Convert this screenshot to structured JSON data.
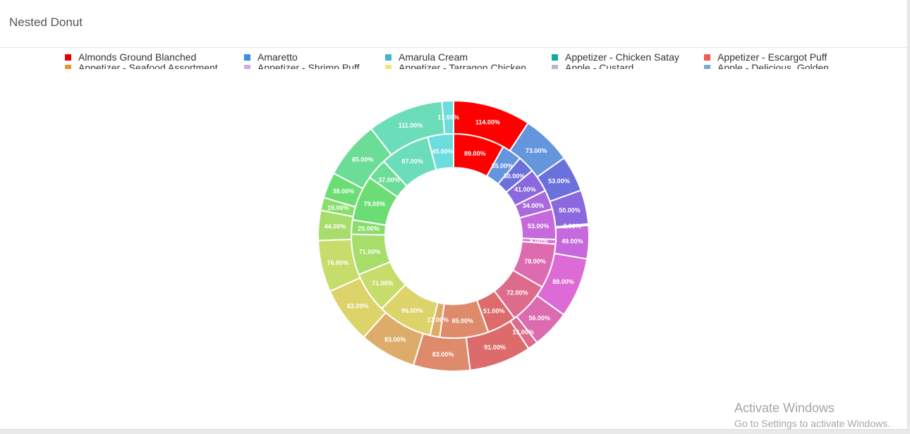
{
  "card": {
    "title": "Nested Donut"
  },
  "legend": {
    "items": [
      {
        "label": "Almonds Ground Blanched",
        "color": "#e60000"
      },
      {
        "label": "Amaretto",
        "color": "#3a8ee0"
      },
      {
        "label": "Amarula Cream",
        "color": "#49b4cf"
      },
      {
        "label": "Appetizer - Chicken Satay",
        "color": "#13a89e"
      },
      {
        "label": "Appetizer - Escargot Puff",
        "color": "#ec5b56"
      },
      {
        "label": "Appetizer - Seafood Assortment",
        "color": "#f28e2b"
      },
      {
        "label": "Appetizer - Shrimp Puff",
        "color": "#d7a9e3"
      },
      {
        "label": "Appetizer - Tarragon Chicken",
        "color": "#f4e27a"
      },
      {
        "label": "Apple - Custard",
        "color": "#b8b8c8"
      },
      {
        "label": "Apple - Delicious, Golden",
        "color": "#7fa8cf"
      }
    ]
  },
  "chart_data": {
    "type": "nested-donut",
    "value_format": "percent",
    "outer_ring": {
      "values": [
        114,
        73,
        53,
        50,
        2,
        49,
        88,
        56,
        15,
        91,
        83,
        83,
        83,
        76,
        44,
        19,
        38,
        85,
        111,
        17
      ],
      "labels": [
        "114.00%",
        "73.00%",
        "53.00%",
        "50.00%",
        "2.00%",
        "49.00%",
        "88.00%",
        "56.00%",
        "15.00%",
        "91.00%",
        "83.00%",
        "83.00%",
        "83.00%",
        "76.00%",
        "44.00%",
        "19.00%",
        "38.00%",
        "85.00%",
        "111.00%",
        "17.00%"
      ],
      "colors": [
        "#ff0000",
        "#6495dd",
        "#6a71dd",
        "#8b68dd",
        "#a96add",
        "#c669dd",
        "#dd6bd6",
        "#dd6bb0",
        "#dd6b8c",
        "#dd6b6b",
        "#dd8b6b",
        "#ddac6b",
        "#ddd36b",
        "#c6dd6b",
        "#a7dd6b",
        "#89dd6b",
        "#6bdd74",
        "#6bdd96",
        "#6bddb8",
        "#6bdddd"
      ]
    },
    "inner_ring": {
      "values": [
        89,
        35,
        30,
        41,
        34,
        53,
        8,
        78,
        72,
        51,
        85,
        17,
        96,
        71,
        71,
        25,
        79,
        37,
        87,
        45
      ],
      "labels": [
        "89.00%",
        "35.00%",
        "30.00%",
        "41.00%",
        "34.00%",
        "53.00%",
        "8.00%",
        "78.00%",
        "72.00%",
        "51.00%",
        "85.00%",
        "17.00%",
        "96.00%",
        "71.00%",
        "71.00%",
        "25.00%",
        "79.00%",
        "37.00%",
        "87.00%",
        "45.00%"
      ],
      "colors": [
        "#ff0000",
        "#6495dd",
        "#6a71dd",
        "#8b68dd",
        "#a96add",
        "#c669dd",
        "#dd6bd6",
        "#dd6bb0",
        "#dd6b8c",
        "#dd6b6b",
        "#dd8b6b",
        "#ddac6b",
        "#ddd36b",
        "#c6dd6b",
        "#a7dd6b",
        "#89dd6b",
        "#6bdd74",
        "#6bdd96",
        "#6bddb8",
        "#6bdddd"
      ]
    }
  },
  "watermark": {
    "title": "Activate Windows",
    "subtitle": "Go to Settings to activate Windows."
  }
}
